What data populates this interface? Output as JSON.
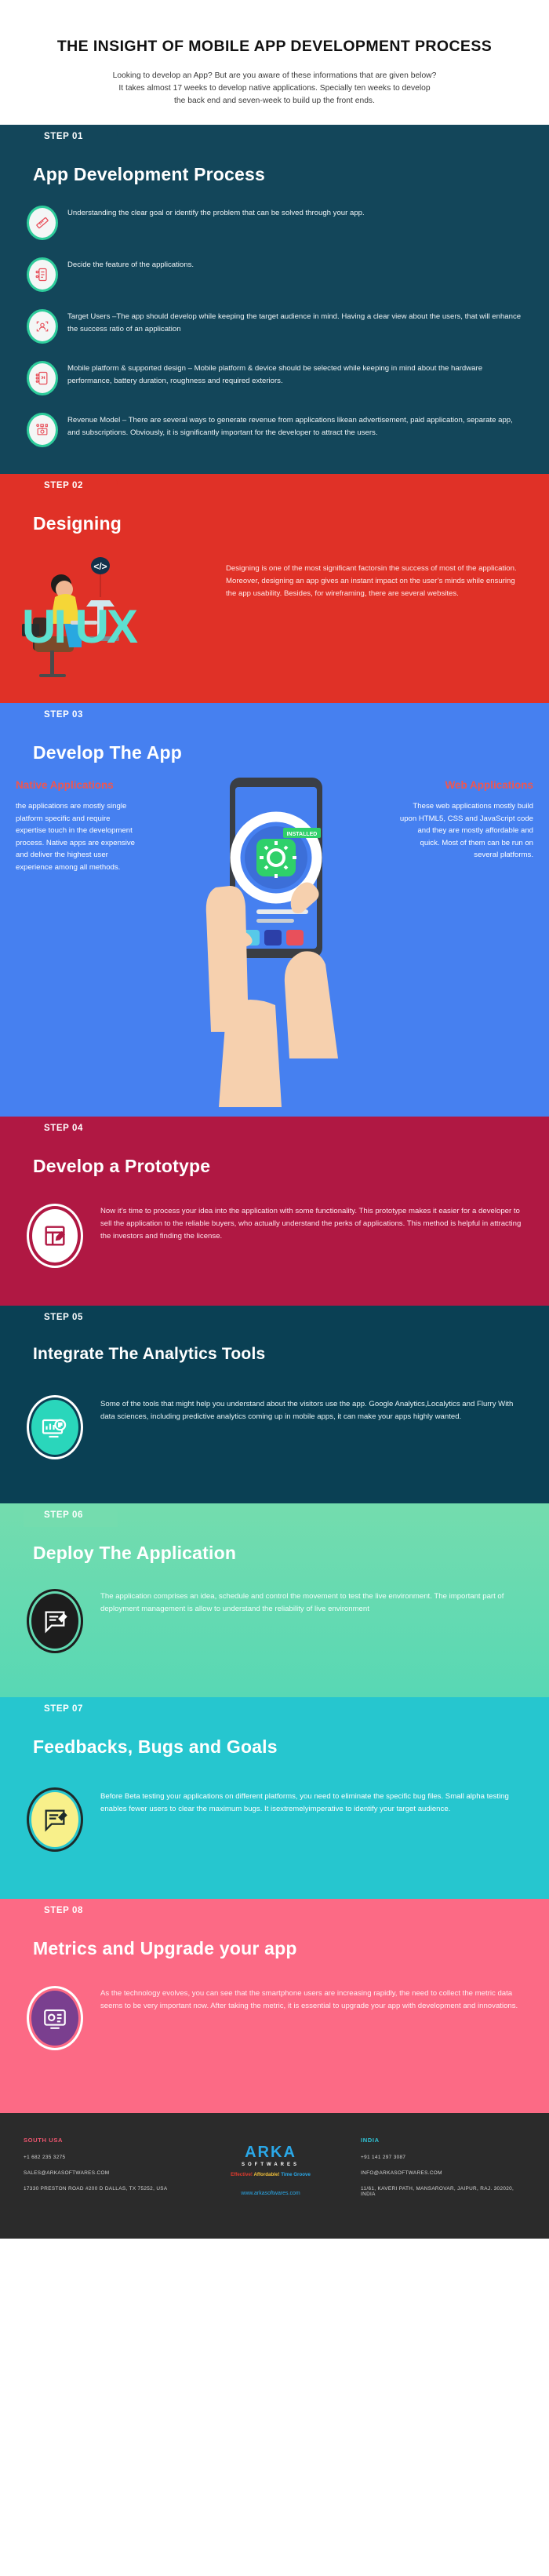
{
  "header": {
    "title": "THE INSIGHT OF MOBILE APP DEVELOPMENT PROCESS",
    "intro_line1": "Looking to develop an App? But are you aware of these informations  that are given below?",
    "intro_line2": "It takes almost 17 weeks to develop native applications. Specially ten weeks to develop",
    "intro_line3": "the back end and seven-week to build up the front ends."
  },
  "steps": [
    {
      "tab": "STEP 01",
      "title": "App Development Process",
      "color": "#13465a",
      "items": [
        {
          "icon": "ruler-pencil-icon",
          "text": "Understanding the clear goal or identify the problem that can be solved through your app."
        },
        {
          "icon": "mobile-feature-icon",
          "text": "Decide the feature of the applications."
        },
        {
          "icon": "target-user-icon",
          "text": "Target Users –The app should develop while keeping the target audience in mind. Having a clear view about the users, that will enhance the success ratio of an application"
        },
        {
          "icon": "mobile-platform-icon",
          "text": "Mobile platform & supported design – Mobile platform & device should be selected while keeping in mind about the hardware performance, battery duration, roughness and required exteriors."
        },
        {
          "icon": "revenue-model-icon",
          "text": "Revenue Model – There are several ways to generate revenue from applications likean advertisement, paid application, separate app, and subscriptions. Obviously, it is significantly important for the developer to attract the users."
        }
      ]
    },
    {
      "tab": "STEP 02",
      "title": "Designing",
      "color": "#e03127",
      "illustration_word": "UI UX",
      "body": "Designing is one of the most significant factorsin the success of most of the application. Moreover, designing an app gives an instant impact on the user’s minds while ensuring the app usability. Besides, for wireframing, there are several websites."
    },
    {
      "tab": "STEP 03",
      "title": "Develop The App",
      "color": "#4680f0",
      "left_heading": "Native Applications",
      "left_body": "the applications are mostly single platform specific and require expertise touch in the development process. Native apps are expensive and deliver the highest user experience among all methods.",
      "right_heading": "Web Applications",
      "right_body": "These web applications mostly build upon HTML5, CSS and JavaScript code and they are mostly affordable and quick. Most of them can be run on several platforms.",
      "phone_badge": "INSTALLED"
    },
    {
      "tab": "STEP 04",
      "title": "Develop a Prototype",
      "color": "#b01843",
      "icon": "prototype-blueprint-icon",
      "body": "Now it’s time to process your idea into the application with some functionality. This prototype makes it easier for a developer to sell the application to the reliable buyers, who actually understand the perks of applications. This method is helpful in attracting the investors and finding the license."
    },
    {
      "tab": "STEP 05",
      "title": "Integrate The Analytics Tools",
      "color": "#0a4054",
      "icon": "analytics-gear-icon",
      "body": "Some of the tools that might help you understand about the visitors use the app. Google Analytics,Localytics and Flurry With data sciences, including predictive analytics coming up in mobile apps, it can make your apps highly wanted."
    },
    {
      "tab": "STEP 06",
      "title": "Deploy The Application",
      "color": "#74dcae",
      "icon": "deploy-edit-icon",
      "body": "The application comprises an idea, schedule and control the movement to test the live environment. The important part of deployment management is allow to understand the reliability of live environment"
    },
    {
      "tab": "STEP 07",
      "title": "Feedbacks, Bugs and Goals",
      "color": "#26c6cf",
      "icon": "feedback-edit-icon",
      "body": "Before Beta testing your applications on different platforms, you need to eliminate the specific bug files. Small alpha testing enables fewer users to clear the maximum bugs. It isextremelyimperative to identify your target audience."
    },
    {
      "tab": "STEP 08",
      "title": "Metrics and Upgrade your app",
      "color": "#fc6a85",
      "icon": "metrics-icon",
      "body": "As the technology evolves, you can see that the smartphone users are increasing rapidly, the need to collect the metric data seems to be very important now. After taking the metric, it is essential to upgrade your app with development and innovations."
    }
  ],
  "footer": {
    "usa": {
      "heading": "SOUTH USA",
      "phone": "+1 682 235 3275",
      "email": "SALES@ARKASOFTWARES.COM",
      "address": "17330 PRESTON ROAD #200 D DALLAS, TX 75252, USA"
    },
    "india": {
      "heading": "INDIA",
      "phone": "+91 141 297 3087",
      "email": "INFO@ARKASOFTWARES.COM",
      "address": "11/61, KAVERI PATH, MANSAROVAR, JAIPUR, RAJ. 302020, INDIA"
    },
    "logo": {
      "name": "ARKA",
      "sub": "SOFTWARES",
      "tag1": "Effective!",
      "tag2": "Affordable!",
      "tag3": "Time Groove",
      "url": "www.arkasoftwares.com"
    }
  }
}
